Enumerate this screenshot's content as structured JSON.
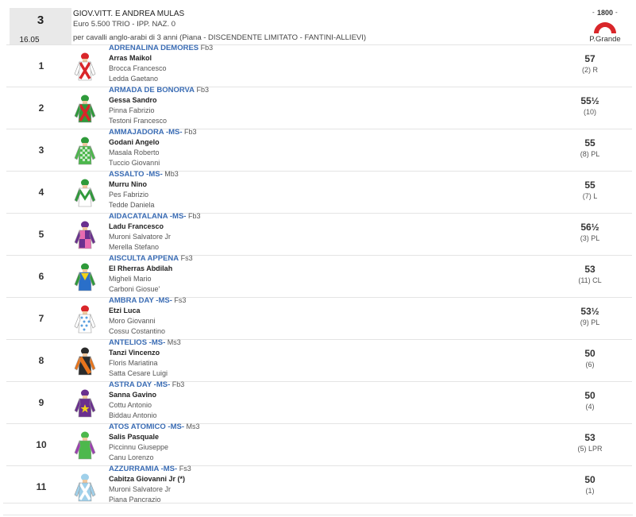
{
  "race": {
    "number": "3",
    "time": "16.05",
    "title": "GIOV.VITT. E ANDREA MULAS",
    "prize": "Euro 5.500 TRIO - IPP. NAZ. 0",
    "description": "per cavalli anglo-arabi di 3 anni (Piana -  DISCENDENTE LIMITATO  - FANTINI-ALLIEVI)",
    "track_badge": "1800",
    "track_name": "P.Grande"
  },
  "colors": {
    "link": "#3a6cb4",
    "badge_red": "#d9262a",
    "header_bg": "#e9e9e9"
  },
  "entries": [
    {
      "no": "1",
      "horse": "ADRENALINA DEMORES",
      "suffix": "Fb3",
      "jockey": "Arras Maikol",
      "trainer": "Brocca Francesco",
      "owner": "Ledda Gaetano",
      "weight": "57",
      "draw": "(2) R",
      "silk_icon": "jockey-silk-white-red-cross-icon"
    },
    {
      "no": "2",
      "horse": "ARMADA DE BONORVA",
      "suffix": "Fb3",
      "jockey": "Gessa Sandro",
      "trainer": "Pinna Fabrizio",
      "owner": "Testoni Francesco",
      "weight": "55½",
      "draw": "(10)",
      "silk_icon": "jockey-silk-green-red-cross-icon"
    },
    {
      "no": "3",
      "horse": "AMMAJADORA -MS-",
      "suffix": "Fb3",
      "jockey": "Godani Angelo",
      "trainer": "Masala Roberto",
      "owner": "Tuccio Giovanni",
      "weight": "55",
      "draw": "(8) PL",
      "silk_icon": "jockey-silk-green-check-icon"
    },
    {
      "no": "4",
      "horse": "ASSALTO -MS-",
      "suffix": "Mb3",
      "jockey": "Murru Nino",
      "trainer": "Pes Fabrizio",
      "owner": "Tedde Daniela",
      "weight": "55",
      "draw": "(7) L",
      "silk_icon": "jockey-silk-white-green-chevron-icon"
    },
    {
      "no": "5",
      "horse": "AIDACATALANA -MS-",
      "suffix": "Fb3",
      "jockey": "Ladu Francesco",
      "trainer": "Muroni Salvatore Jr",
      "owner": "Merella Stefano",
      "weight": "56½",
      "draw": "(3) PL",
      "silk_icon": "jockey-silk-purple-pink-quarters-icon"
    },
    {
      "no": "6",
      "horse": "AISCULTA APPENA",
      "suffix": "Fs3",
      "jockey": "El Rherras Abdilah",
      "trainer": "Migheli Mario",
      "owner": "Carboni Giosue'",
      "weight": "53",
      "draw": "(11) CL",
      "silk_icon": "jockey-silk-blue-green-yellow-icon"
    },
    {
      "no": "7",
      "horse": "AMBRA DAY -MS-",
      "suffix": "Fs3",
      "jockey": "Etzi Luca",
      "trainer": "Moro Giovanni",
      "owner": "Cossu Costantino",
      "weight": "53½",
      "draw": "(9) PL",
      "silk_icon": "jockey-silk-white-blue-spots-icon"
    },
    {
      "no": "8",
      "horse": "ANTELIOS -MS-",
      "suffix": "Ms3",
      "jockey": "Tanzi Vincenzo",
      "trainer": "Floris Mariatina",
      "owner": "Satta Cesare Luigi",
      "weight": "50",
      "draw": "(6)",
      "silk_icon": "jockey-silk-black-orange-sash-icon"
    },
    {
      "no": "9",
      "horse": "ASTRA DAY -MS-",
      "suffix": "Fb3",
      "jockey": "Sanna Gavino",
      "trainer": "Cottu Antonio",
      "owner": "Biddau Antonio",
      "weight": "50",
      "draw": "(4)",
      "silk_icon": "jockey-silk-purple-yellow-star-icon"
    },
    {
      "no": "10",
      "horse": "ATOS ATOMICO -MS-",
      "suffix": "Ms3",
      "jockey": "Salis Pasquale",
      "trainer": "Piccinnu Giuseppe",
      "owner": "Canu Lorenzo",
      "weight": "53",
      "draw": "(5) LPR",
      "silk_icon": "jockey-silk-green-purple-icon"
    },
    {
      "no": "11",
      "horse": "AZZURRAMIA -MS-",
      "suffix": "Fs3",
      "jockey": "Cabitza Giovanni Jr (*)",
      "trainer": "Muroni Salvatore Jr",
      "owner": "Piana Pancrazio",
      "weight": "50",
      "draw": "(1)",
      "silk_icon": "jockey-silk-lightblue-white-cross-icon"
    }
  ]
}
